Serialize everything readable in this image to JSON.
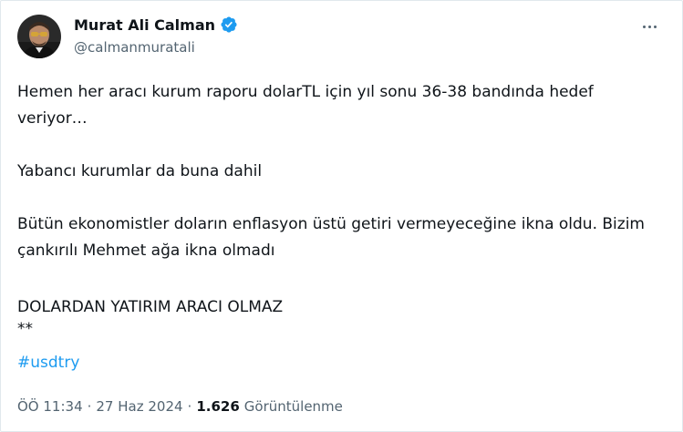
{
  "author": {
    "display_name": "Murat Ali Calman",
    "handle": "@calmanmuratali",
    "verified": true
  },
  "tweet": {
    "line1": "Hemen her aracı kurum raporu dolarTL için yıl sonu 36-38 bandında hedef veriyor…",
    "line2": "Yabancı kurumlar da buna dahil",
    "line3": "Bütün ekonomistler doların enflasyon üstü getiri vermeyeceğine ikna oldu. Bizim çankırılı Mehmet ağa ikna olmadı",
    "line4": "DOLARDAN YATIRIM ARACI OLMAZ",
    "line5": "**",
    "hashtag": "#usdtry"
  },
  "meta": {
    "time": "ÖÖ 11:34",
    "separator1": "·",
    "date": "27 Haz 2024",
    "separator2": "·",
    "views_count": "1.626",
    "views_label": "Görüntülenme"
  },
  "colors": {
    "text": "#0f1419",
    "secondary": "#536471",
    "link": "#1d9bf0",
    "verified": "#1d9bf0"
  },
  "icons": {
    "verified": "verified-badge-icon",
    "more": "more-horizontal-icon"
  }
}
